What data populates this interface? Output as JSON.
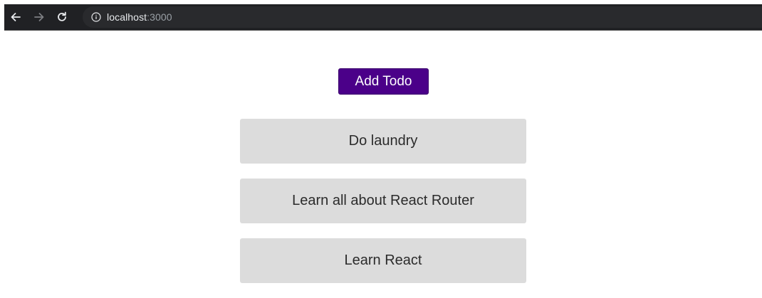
{
  "browser": {
    "url_host": "localhost",
    "url_port": ":3000",
    "icons": {
      "back": "arrow-left-icon",
      "forward": "arrow-right-icon",
      "reload": "reload-icon",
      "info": "info-circle-icon"
    },
    "colors": {
      "toolbar_bg": "#202124",
      "omnibox_bg": "#292a2d"
    }
  },
  "main": {
    "add_button_label": "Add Todo",
    "todos": [
      {
        "label": "Do laundry"
      },
      {
        "label": "Learn all about React Router"
      },
      {
        "label": "Learn React"
      }
    ],
    "colors": {
      "accent": "#4b0089",
      "todo_bg": "#dcdcdc"
    }
  }
}
